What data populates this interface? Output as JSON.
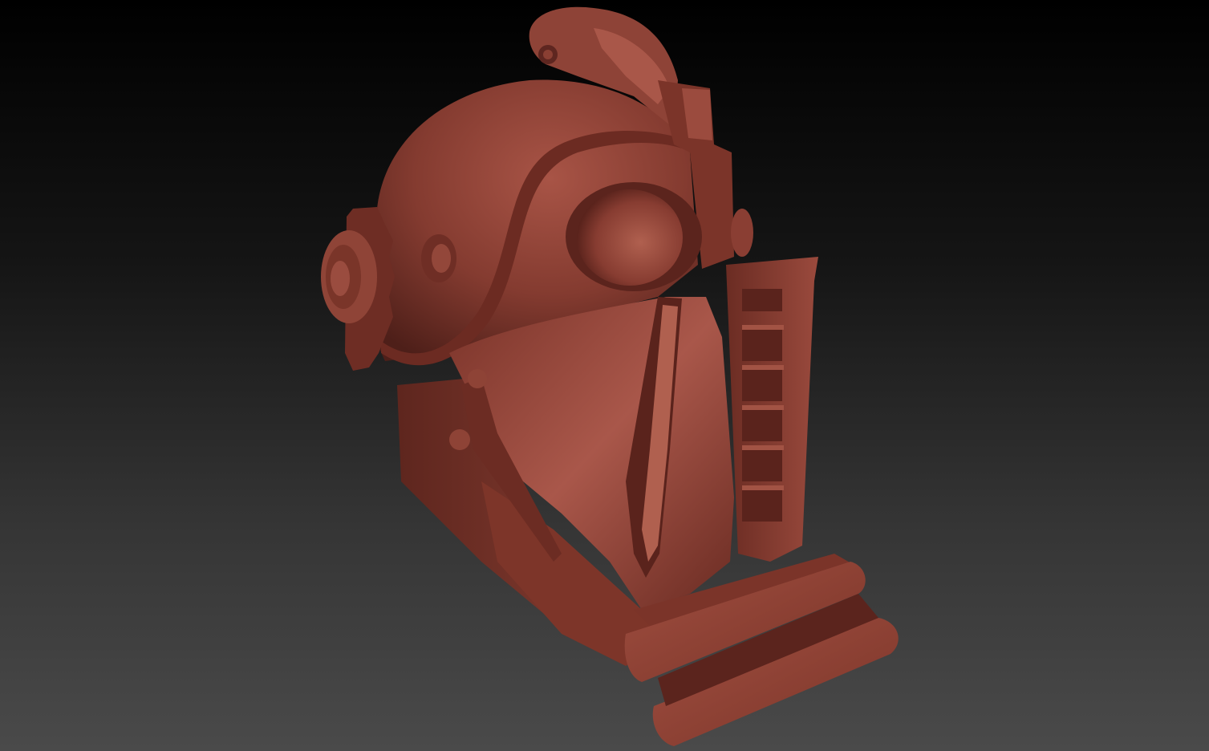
{
  "viewport": {
    "background_top": "#000000",
    "background_bottom": "#4a4a4a"
  },
  "model": {
    "subject": "gas-mask-helmet",
    "material_color": "#8a3e33",
    "highlight_color": "#b45a4c",
    "shadow_color": "#4a1d17"
  }
}
